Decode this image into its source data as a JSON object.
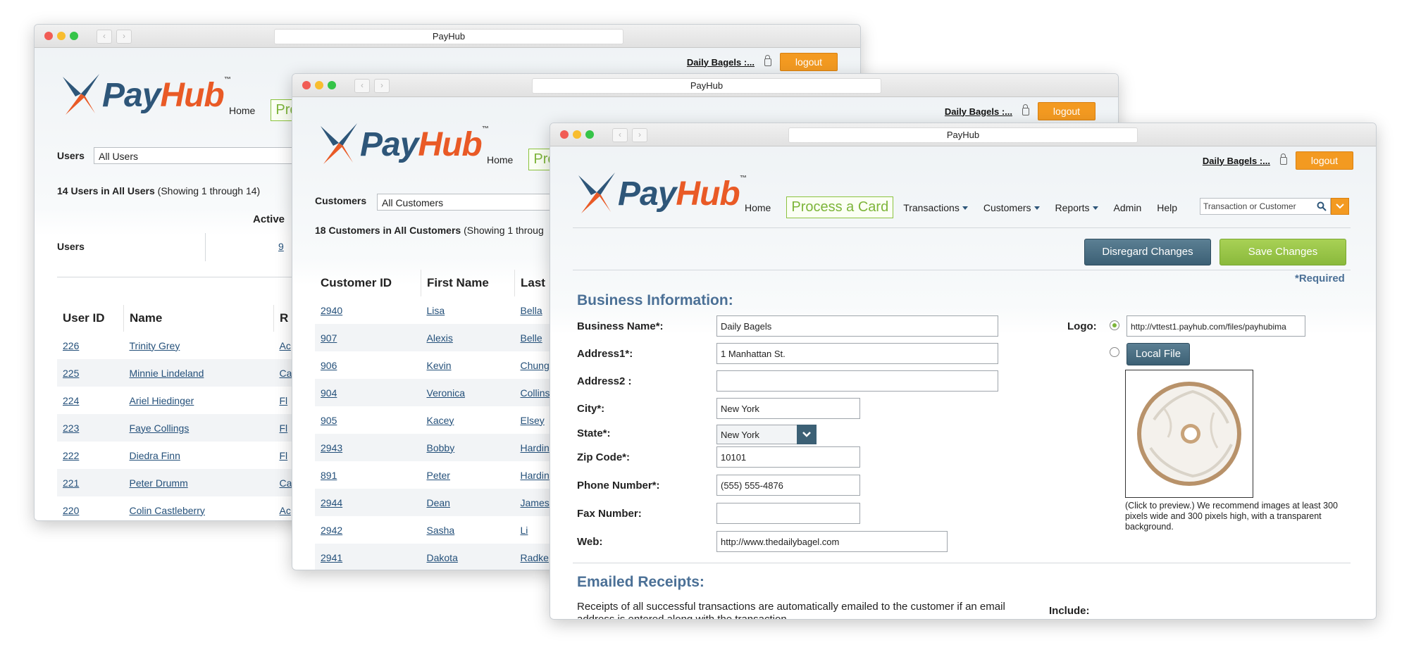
{
  "browser": {
    "title": "PayHub",
    "back": "‹",
    "forward": "›"
  },
  "header": {
    "account": "Daily Bagels :...",
    "logout": "logout",
    "logo_pay": "Pay",
    "logo_hub": "Hub",
    "logo_tm": "™"
  },
  "menu": {
    "home": "Home",
    "process": "Process a Card",
    "process_short": "Pro",
    "transactions": "Transactions",
    "customers": "Customers",
    "reports": "Reports",
    "admin": "Admin",
    "help": "Help",
    "search_placeholder": "Transaction or Customer"
  },
  "users_window": {
    "filter_label": "Users",
    "filter_value": "All Users",
    "count_bold": "14 Users in All Users",
    "count_rest": " (Showing 1 through 14)",
    "active_header": "Active",
    "users_row_label": "Users",
    "users_row_active": "9",
    "columns": [
      "User ID",
      "Name",
      "R"
    ],
    "rows": [
      {
        "id": "226",
        "name": "Trinity Grey",
        "r": "Ac"
      },
      {
        "id": "225",
        "name": "Minnie Lindeland",
        "r": "Ca"
      },
      {
        "id": "224",
        "name": "Ariel Hiedinger",
        "r": "Fl"
      },
      {
        "id": "223",
        "name": "Faye Collings",
        "r": "Fl"
      },
      {
        "id": "222",
        "name": "Diedra Finn",
        "r": "Fl"
      },
      {
        "id": "221",
        "name": "Peter Drumm",
        "r": "Ca"
      },
      {
        "id": "220",
        "name": "Colin Castleberry",
        "r": "Ac"
      }
    ]
  },
  "customers_window": {
    "filter_label": "Customers",
    "filter_value": "All Customers",
    "count_bold": "18 Customers in All Customers",
    "count_rest": " (Showing 1 throug",
    "columns": [
      "Customer ID",
      "First Name",
      "Last"
    ],
    "rows": [
      {
        "id": "2940",
        "first": "Lisa",
        "last": "Bella"
      },
      {
        "id": "907",
        "first": "Alexis",
        "last": "Belle"
      },
      {
        "id": "906",
        "first": "Kevin",
        "last": "Chung"
      },
      {
        "id": "904",
        "first": "Veronica",
        "last": "Collins"
      },
      {
        "id": "905",
        "first": "Kacey",
        "last": "Elsey"
      },
      {
        "id": "2943",
        "first": "Bobby",
        "last": "Hardin"
      },
      {
        "id": "891",
        "first": "Peter",
        "last": "Hardin"
      },
      {
        "id": "2944",
        "first": "Dean",
        "last": "James"
      },
      {
        "id": "2942",
        "first": "Sasha",
        "last": "Li"
      },
      {
        "id": "2941",
        "first": "Dakota",
        "last": "Radke"
      }
    ]
  },
  "business_window": {
    "disregard": "Disregard Changes",
    "save": "Save Changes",
    "required": "*Required",
    "section_title": "Business Information:",
    "fields": {
      "business_name_label": "Business Name*:",
      "business_name": "Daily Bagels",
      "address1_label": "Address1*:",
      "address1": "1 Manhattan St.",
      "address2_label": "Address2 :",
      "address2": "",
      "city_label": "City*:",
      "city": "New York",
      "state_label": "State*:",
      "state": "New York",
      "zip_label": "Zip Code*:",
      "zip": "10101",
      "phone_label": "Phone Number*:",
      "phone": "(555) 555-4876",
      "fax_label": "Fax Number:",
      "fax": "",
      "web_label": "Web:",
      "web": "http://www.thedailybagel.com"
    },
    "logo_label": "Logo:",
    "logo_url": "http://vttest1.payhub.com/files/payhubima",
    "local_file": "Local File",
    "logo_note": "(Click to preview.) We recommend images at least 300 pixels wide and 300 pixels high, with a transparent background.",
    "receipts_title": "Emailed Receipts:",
    "receipts_text": "Receipts of all successful transactions are automatically emailed to the customer if an email address is entered along with the transaction.",
    "include_label": "Include:"
  }
}
